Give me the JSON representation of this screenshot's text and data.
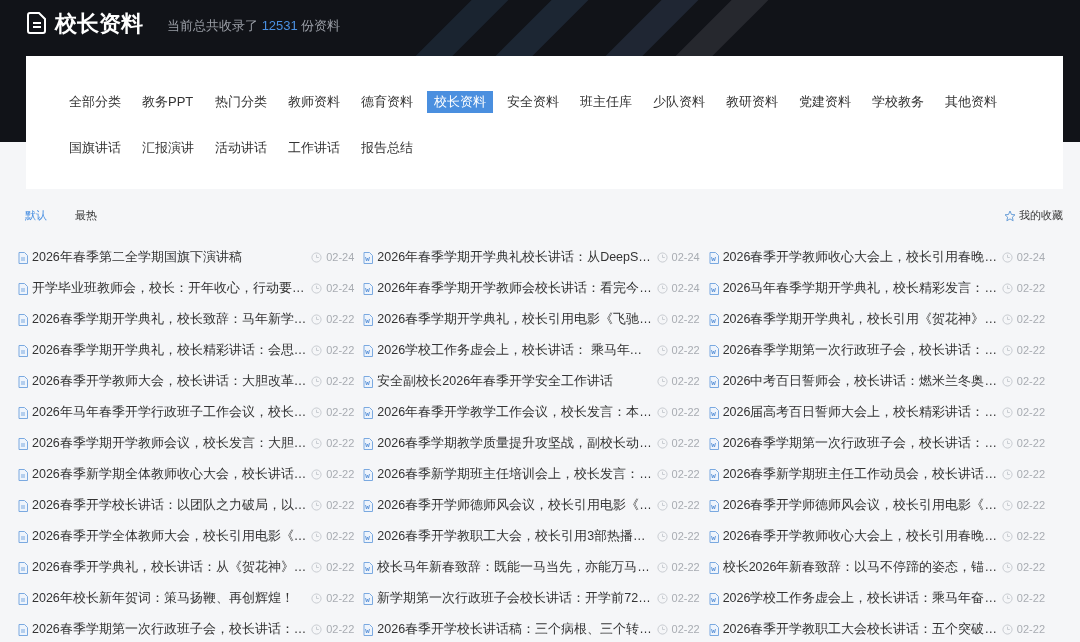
{
  "header": {
    "title": "校长资料",
    "summary_prefix": "当前总共收录了",
    "count": "12531",
    "summary_suffix": "份资料"
  },
  "categories": [
    {
      "label": "全部分类",
      "selected": false
    },
    {
      "label": "教务PPT",
      "selected": false
    },
    {
      "label": "热门分类",
      "selected": false
    },
    {
      "label": "教师资料",
      "selected": false
    },
    {
      "label": "德育资料",
      "selected": false
    },
    {
      "label": "校长资料",
      "selected": true
    },
    {
      "label": "安全资料",
      "selected": false
    },
    {
      "label": "班主任库",
      "selected": false
    },
    {
      "label": "少队资料",
      "selected": false
    },
    {
      "label": "教研资料",
      "selected": false
    },
    {
      "label": "党建资料",
      "selected": false
    },
    {
      "label": "学校教务",
      "selected": false
    },
    {
      "label": "其他资料",
      "selected": false
    },
    {
      "label": "国旗讲话",
      "selected": false
    },
    {
      "label": "汇报演讲",
      "selected": false
    },
    {
      "label": "活动讲话",
      "selected": false
    },
    {
      "label": "工作讲话",
      "selected": false
    },
    {
      "label": "报告总结",
      "selected": false
    }
  ],
  "sort_tabs": [
    {
      "label": "默认",
      "selected": true
    },
    {
      "label": "最热",
      "selected": false
    }
  ],
  "favorites_link": "我的收藏",
  "columns": [
    {
      "items": [
        {
          "kind": "text",
          "title": "2026年春季第二全学期国旗下演讲稿",
          "date": "02-24"
        },
        {
          "kind": "text",
          "title": "开学毕业班教师会，校长：开年收心，行动要…",
          "date": "02-24"
        },
        {
          "kind": "text",
          "title": "2026春季学期开学典礼，校长致辞：马年新学…",
          "date": "02-22"
        },
        {
          "kind": "text",
          "title": "2026春季学期开学典礼，校长精彩讲话：会思…",
          "date": "02-22"
        },
        {
          "kind": "text",
          "title": "2026春季开学教师大会，校长讲话：大胆改革…",
          "date": "02-22"
        },
        {
          "kind": "text",
          "title": "2026年马年春季开学行政班子工作会议，校长…",
          "date": "02-22"
        },
        {
          "kind": "text",
          "title": "2026春季学期开学教师会议，校长发言：大胆…",
          "date": "02-22"
        },
        {
          "kind": "text",
          "title": "2026春季新学期全体教师收心大会，校长讲话…",
          "date": "02-22"
        },
        {
          "kind": "text",
          "title": "2026春季开学校长讲话：以团队之力破局，以…",
          "date": "02-22"
        },
        {
          "kind": "text",
          "title": "2026春季开学全体教师大会，校长引用电影《…",
          "date": "02-22"
        },
        {
          "kind": "text",
          "title": "2026春季开学典礼，校长讲话：从《贺花神》…",
          "date": "02-22"
        },
        {
          "kind": "text",
          "title": "2026年校长新年贺词：策马扬鞭、再创辉煌！",
          "date": "02-22"
        },
        {
          "kind": "text",
          "title": "2026春季学期第一次行政班子会，校长讲话：…",
          "date": "02-22"
        }
      ]
    },
    {
      "items": [
        {
          "kind": "word",
          "title": "2026年春季学期开学典礼校长讲话：从DeepS…",
          "date": "02-24"
        },
        {
          "kind": "word",
          "title": "2026年春季学期开学教师会校长讲话：看完今…",
          "date": "02-24"
        },
        {
          "kind": "word",
          "title": "2026春季学期开学典礼，校长引用电影《飞驰…",
          "date": "02-22"
        },
        {
          "kind": "word",
          "title": "2026学校工作务虚会上，校长讲话： 乘马年…",
          "date": "02-22"
        },
        {
          "kind": "word",
          "title": "安全副校长2026年春季开学安全工作讲话",
          "date": "02-22"
        },
        {
          "kind": "word",
          "title": "2026年春季开学教学工作会议，校长发言：本…",
          "date": "02-22"
        },
        {
          "kind": "word",
          "title": "2026春季学期教学质量提升攻坚战，副校长动…",
          "date": "02-22"
        },
        {
          "kind": "word",
          "title": "2026春季新学期班主任培训会上，校长发言：…",
          "date": "02-22"
        },
        {
          "kind": "word",
          "title": "2026春季开学师德师风会议，校长引用电影《…",
          "date": "02-22"
        },
        {
          "kind": "word",
          "title": "2026春季开学教职工大会，校长引用3部热播…",
          "date": "02-22"
        },
        {
          "kind": "word",
          "title": "校长马年新春致辞：既能一马当先，亦能万马…",
          "date": "02-22"
        },
        {
          "kind": "word",
          "title": "新学期第一次行政班子会校长讲话：开学前72…",
          "date": "02-22"
        },
        {
          "kind": "word",
          "title": "2026春季开学校长讲话稿：三个病根、三个转…",
          "date": "02-22"
        }
      ]
    },
    {
      "items": [
        {
          "kind": "word",
          "title": "2026春季开学教师收心大会上，校长引用春晚…",
          "date": "02-24"
        },
        {
          "kind": "word",
          "title": "2026马年春季学期开学典礼，校长精彩发言：…",
          "date": "02-22"
        },
        {
          "kind": "word",
          "title": "2026春季学期开学典礼，校长引用《贺花神》…",
          "date": "02-22"
        },
        {
          "kind": "word",
          "title": "2026春季学期第一次行政班子会，校长讲话：…",
          "date": "02-22"
        },
        {
          "kind": "word",
          "title": "2026中考百日誓师会，校长讲话：燃米兰冬奥…",
          "date": "02-22"
        },
        {
          "kind": "word",
          "title": "2026届高考百日誓师大会上，校长精彩讲话：…",
          "date": "02-22"
        },
        {
          "kind": "word",
          "title": "2026春季学期第一次行政班子会，校长讲话：…",
          "date": "02-22"
        },
        {
          "kind": "word",
          "title": "2026春季新学期班主任工作动员会，校长讲话…",
          "date": "02-22"
        },
        {
          "kind": "word",
          "title": "2026春季开学师德师风会议，校长引用电影《…",
          "date": "02-22"
        },
        {
          "kind": "word",
          "title": "2026春季开学教师收心大会上，校长引用春晚…",
          "date": "02-22"
        },
        {
          "kind": "word",
          "title": "校长2026年新春致辞：以马不停蹄的姿态，锚…",
          "date": "02-22"
        },
        {
          "kind": "word",
          "title": "2026学校工作务虚会上，校长讲话：乘马年奋…",
          "date": "02-22"
        },
        {
          "kind": "word",
          "title": "2026春季开学教职工大会校长讲话：五个突破…",
          "date": "02-22"
        }
      ]
    }
  ]
}
